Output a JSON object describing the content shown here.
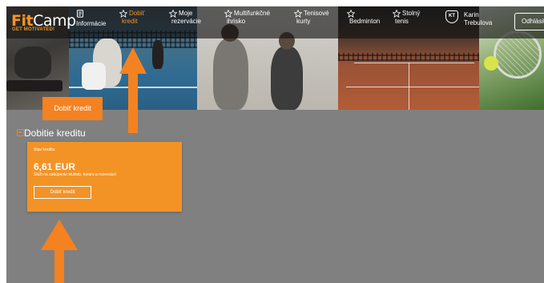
{
  "brand": {
    "name_fit": "Fit",
    "name_camp": "Camp",
    "tagline": "GET MOTIVATED!"
  },
  "nav": {
    "items": [
      {
        "icon": "info-card-icon",
        "line1": "",
        "line2": "Informácie",
        "active": false
      },
      {
        "icon": "star-icon",
        "line1": "Dobiť",
        "line2": "kredit",
        "active": true
      },
      {
        "icon": "star-icon",
        "line1": "Moje",
        "line2": "rezervácie",
        "active": false
      },
      {
        "icon": "star-icon",
        "line1": "Multifunkčné",
        "line2": "ihrisko",
        "active": false
      },
      {
        "icon": "star-icon",
        "line1": "Tenisové",
        "line2": "kurty",
        "active": false
      },
      {
        "icon": "star-icon",
        "line1": "",
        "line2": "Bedminton",
        "active": false
      },
      {
        "icon": "star-icon",
        "line1": "Stolný",
        "line2": "tenis",
        "active": false
      }
    ]
  },
  "user": {
    "initials": "KT",
    "first_name": "Karin",
    "last_name": "Trebulova",
    "logout_label": "Odhlásiť"
  },
  "hero": {
    "button_label": "Dobiť kredit"
  },
  "section": {
    "title": "Dobitie kreditu"
  },
  "card": {
    "label": "Stav kreditu",
    "amount": "6,61 EUR",
    "description": "Slúži na zakúpenie služieb, tovaru a rezervácií",
    "button_label": "Dobiť kredit"
  },
  "colors": {
    "accent": "#f58220",
    "background": "#808080",
    "card": "#f39325"
  }
}
